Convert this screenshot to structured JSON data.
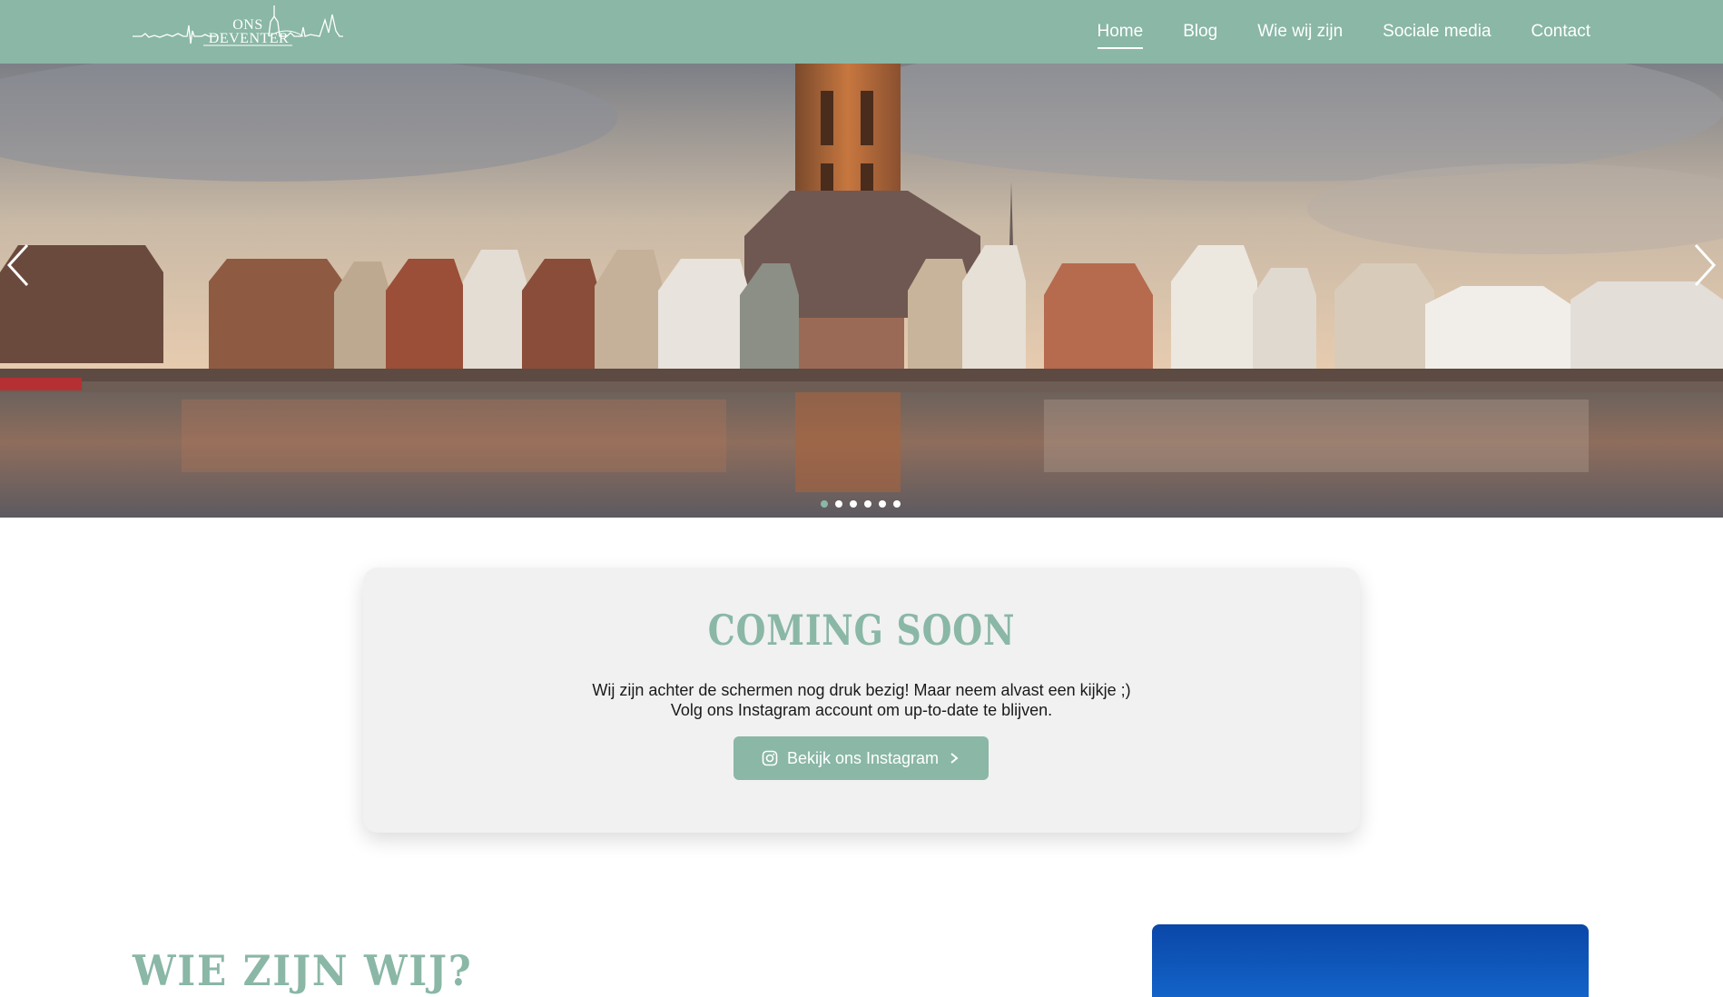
{
  "header": {
    "logo_line1": "ONS",
    "logo_line2": "DEVENTER",
    "nav": [
      {
        "label": "Home",
        "active": true
      },
      {
        "label": "Blog",
        "active": false
      },
      {
        "label": "Wie wij zijn",
        "active": false
      },
      {
        "label": "Sociale media",
        "active": false
      },
      {
        "label": "Contact",
        "active": false
      }
    ]
  },
  "hero": {
    "slide_count": 6,
    "active_slide": 1,
    "prev_icon": "chevron-left-icon",
    "next_icon": "chevron-right-icon"
  },
  "coming_soon": {
    "title": "COMING SOON",
    "line1": "Wij zijn achter de schermen nog druk bezig! Maar neem alvast een kijkje ;)",
    "line2": "Volg ons Instagram account om up-to-date te blijven.",
    "button_label": "Bekijk ons Instagram",
    "button_icon": "instagram-icon"
  },
  "about": {
    "title": "WIE ZIJN WIJ?"
  },
  "colors": {
    "accent": "#8ab7a6",
    "card_bg": "#f1f1f1",
    "text": "#1a1a1a"
  }
}
